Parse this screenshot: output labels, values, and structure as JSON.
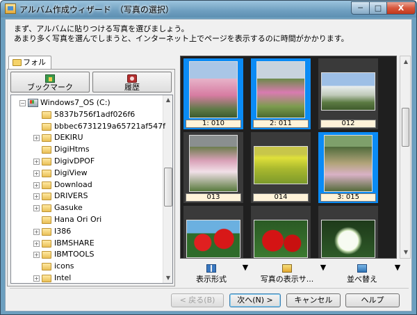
{
  "window": {
    "title": "アルバム作成ウィザード　（写真の選択）",
    "controls": {
      "minimize": "─",
      "maximize": "□",
      "close": "X"
    }
  },
  "instruction": {
    "line1": "まず、アルバムに貼りつける写真を選びましょう。",
    "line2": "あまり多く写真を選んでしまうと、インターネット上でページを表示するのに時間がかかります。"
  },
  "left_pane": {
    "tab_label": "フォルダ",
    "bookmark_label": "ブックマーク",
    "history_label": "履歴",
    "tree": [
      {
        "label": "Windows7_OS (C:)",
        "type": "drive",
        "expander": "−",
        "indent": 0
      },
      {
        "label": "5837b756f1adf026f6",
        "type": "folder",
        "expander": "",
        "indent": 1
      },
      {
        "label": "bbbec6731219a65721af547f",
        "type": "folder",
        "expander": "",
        "indent": 1
      },
      {
        "label": "DEKIRU",
        "type": "folder",
        "expander": "+",
        "indent": 1
      },
      {
        "label": "DigiHtms",
        "type": "folder",
        "expander": "",
        "indent": 1
      },
      {
        "label": "DigivDPOF",
        "type": "folder",
        "expander": "+",
        "indent": 1
      },
      {
        "label": "DigiView",
        "type": "folder",
        "expander": "+",
        "indent": 1
      },
      {
        "label": "Download",
        "type": "folder",
        "expander": "+",
        "indent": 1
      },
      {
        "label": "DRIVERS",
        "type": "folder",
        "expander": "+",
        "indent": 1
      },
      {
        "label": "Gasuke",
        "type": "folder",
        "expander": "+",
        "indent": 1
      },
      {
        "label": "Hana Ori Ori",
        "type": "folder",
        "expander": "",
        "indent": 1
      },
      {
        "label": "I386",
        "type": "folder",
        "expander": "+",
        "indent": 1
      },
      {
        "label": "IBMSHARE",
        "type": "folder",
        "expander": "+",
        "indent": 1
      },
      {
        "label": "IBMTOOLS",
        "type": "folder",
        "expander": "+",
        "indent": 1
      },
      {
        "label": "icons",
        "type": "folder",
        "expander": "",
        "indent": 1
      },
      {
        "label": "Intel",
        "type": "folder",
        "expander": "+",
        "indent": 1
      }
    ],
    "scroll": {
      "up": "▲",
      "down": "▼"
    }
  },
  "photos": [
    {
      "caption": "1: 010",
      "selected": true,
      "orientation": "portrait",
      "scene": "pink-blossom"
    },
    {
      "caption": "2: 011",
      "selected": true,
      "orientation": "portrait",
      "scene": "blossom-garden"
    },
    {
      "caption": "012",
      "selected": false,
      "orientation": "landscape",
      "scene": "white-trees"
    },
    {
      "caption": "013",
      "selected": false,
      "orientation": "portrait",
      "scene": "mixed-blossom"
    },
    {
      "caption": "014",
      "selected": false,
      "orientation": "landscape",
      "scene": "rapeseed"
    },
    {
      "caption": "3: 015",
      "selected": true,
      "orientation": "portrait",
      "scene": "gazebo"
    },
    {
      "caption": "",
      "selected": false,
      "orientation": "landscape",
      "scene": "red-flowers"
    },
    {
      "caption": "",
      "selected": false,
      "orientation": "landscape",
      "scene": "red-flowers-2"
    },
    {
      "caption": "",
      "selected": false,
      "orientation": "landscape",
      "scene": "white-lotus"
    }
  ],
  "photo_scroll": {
    "up": "▲",
    "down": "▼"
  },
  "photo_toolbar": {
    "display_format": "表示形式",
    "show_photo": "写真の表示サ...",
    "sort": "並べ替え",
    "dropdown": "▼"
  },
  "buttons": {
    "back": "< 戻る(B)",
    "next": "次へ(N) >",
    "cancel": "キャンセル",
    "help": "ヘルプ"
  },
  "colors": {
    "selection": "#0a8bf5",
    "thumb_bg": "#3a3a3a",
    "caption_bg": "#fff3d9"
  }
}
